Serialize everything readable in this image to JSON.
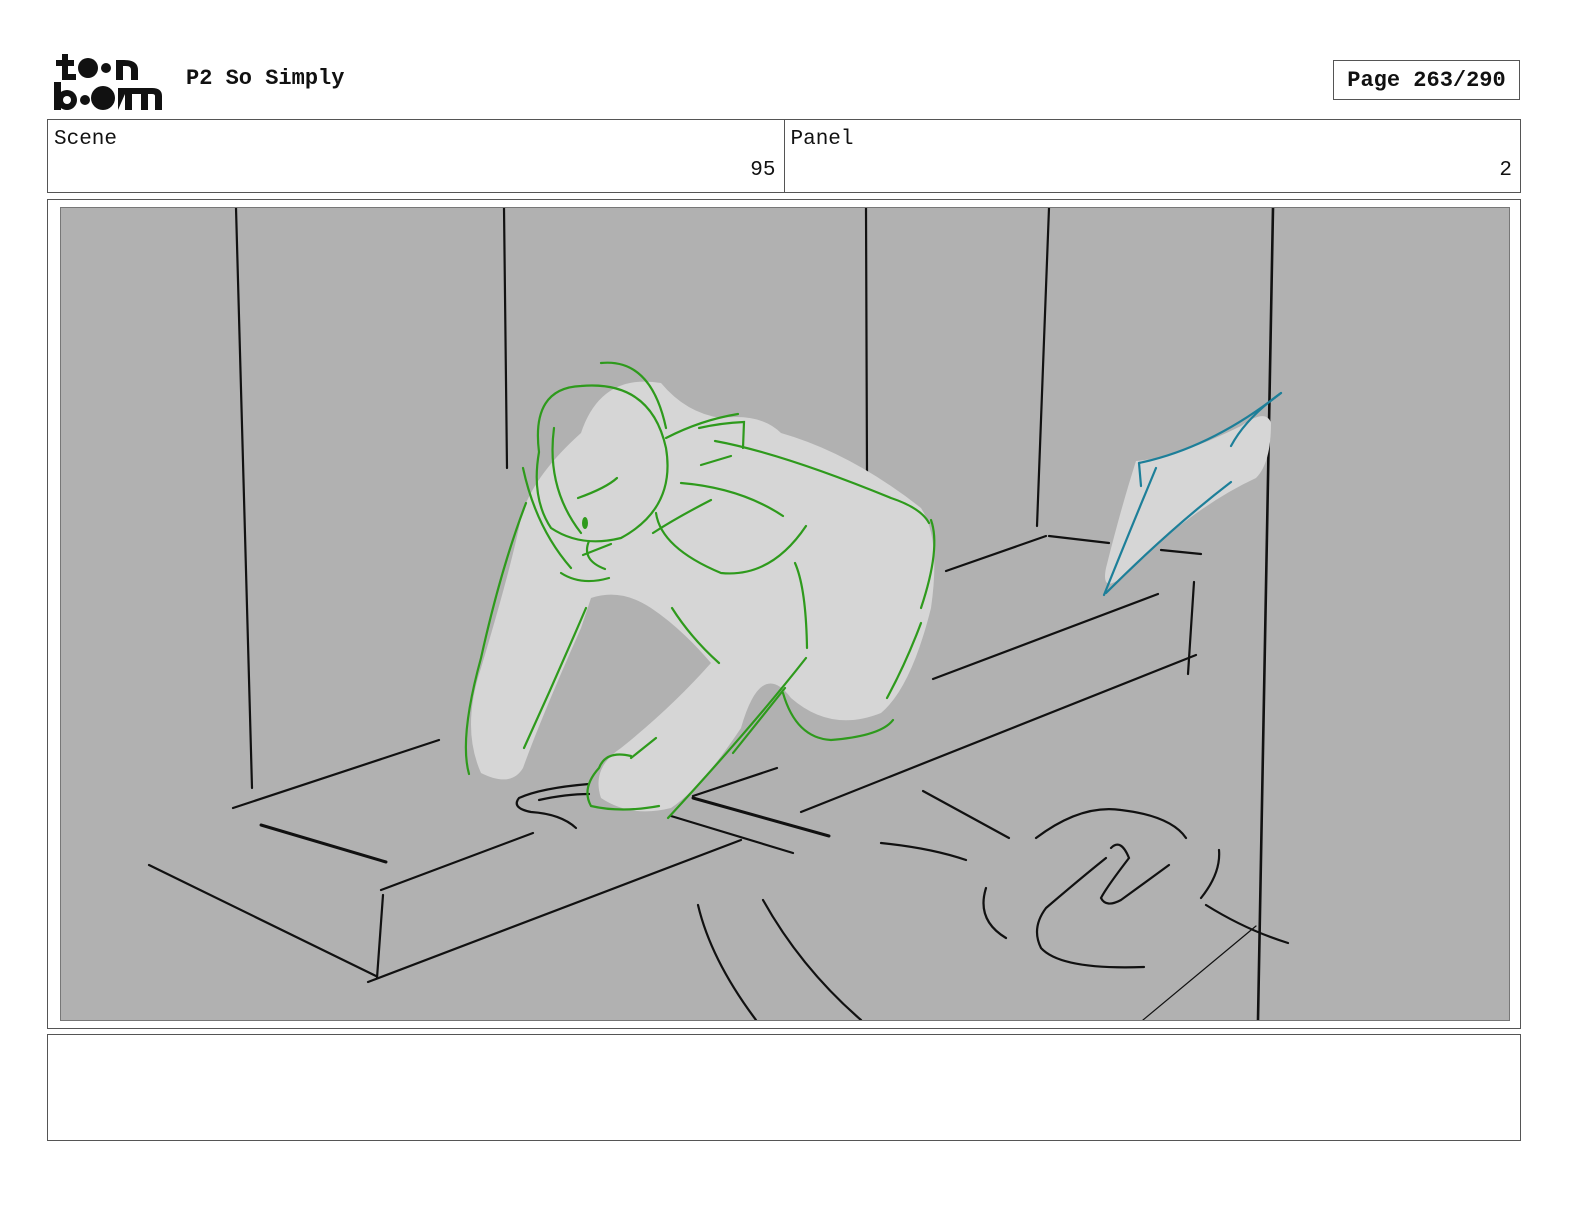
{
  "header": {
    "logo_text": "toon boom",
    "title": "P2 So Simply",
    "page_label": "Page 263/290"
  },
  "info": {
    "scene_label": "Scene",
    "scene_value": "95",
    "panel_label": "Panel",
    "panel_value": "2"
  },
  "panel_image": {
    "description_icon": "storyboard-sketch-figure-crouching-on-ledge",
    "colors": {
      "background": "#b1b1b1",
      "figure_fill": "#d6d6d6",
      "figure_line": "#2e9a1c",
      "object_line": "#1d7f99",
      "ink": "#111111"
    }
  },
  "notes": {
    "text": ""
  }
}
